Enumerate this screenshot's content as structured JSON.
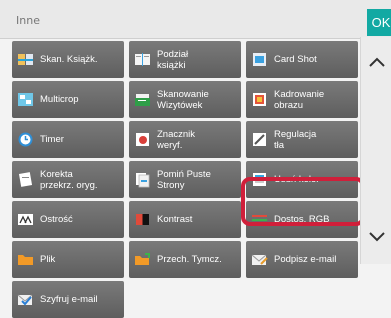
{
  "header": {
    "title": "Inne",
    "ok_label": "OK"
  },
  "colors": {
    "accent": "#12a9a3",
    "highlight": "#d01f3a",
    "button_bg": "#6b6b6b"
  },
  "buttons": [
    {
      "label": "Skan. Książk.",
      "icon": "book-scan-icon"
    },
    {
      "label": "Podział\nksiążki",
      "icon": "book-divide-icon"
    },
    {
      "label": "Card Shot",
      "icon": "card-shot-icon"
    },
    {
      "label": "Multicrop",
      "icon": "multicrop-icon"
    },
    {
      "label": "Skanowanie\nWizytówek",
      "icon": "business-card-icon"
    },
    {
      "label": "Kadrowanie\nobrazu",
      "icon": "crop-icon"
    },
    {
      "label": "Timer",
      "icon": "timer-icon"
    },
    {
      "label": "Znacznik\nweryf.",
      "icon": "verification-stamp-icon"
    },
    {
      "label": "Regulacja\ntła",
      "icon": "background-adjust-icon"
    },
    {
      "label": "Korekta\nprzekrz. oryg.",
      "icon": "skew-correction-icon"
    },
    {
      "label": "Pomiń Puste\nStrony",
      "icon": "skip-blank-icon"
    },
    {
      "label": "Usuń kolor",
      "icon": "color-remove-icon"
    },
    {
      "label": "Ostrość",
      "icon": "sharpness-icon"
    },
    {
      "label": "Kontrast",
      "icon": "contrast-icon"
    },
    {
      "label": "Dostos. RGB",
      "icon": "rgb-adjust-icon"
    },
    {
      "label": "Plik",
      "icon": "folder-icon"
    },
    {
      "label": "Przech. Tymcz.",
      "icon": "quick-file-icon"
    },
    {
      "label": "Podpisz e-mail",
      "icon": "sign-email-icon"
    },
    {
      "label": "Szyfruj e-mail",
      "icon": "encrypt-email-icon"
    }
  ]
}
